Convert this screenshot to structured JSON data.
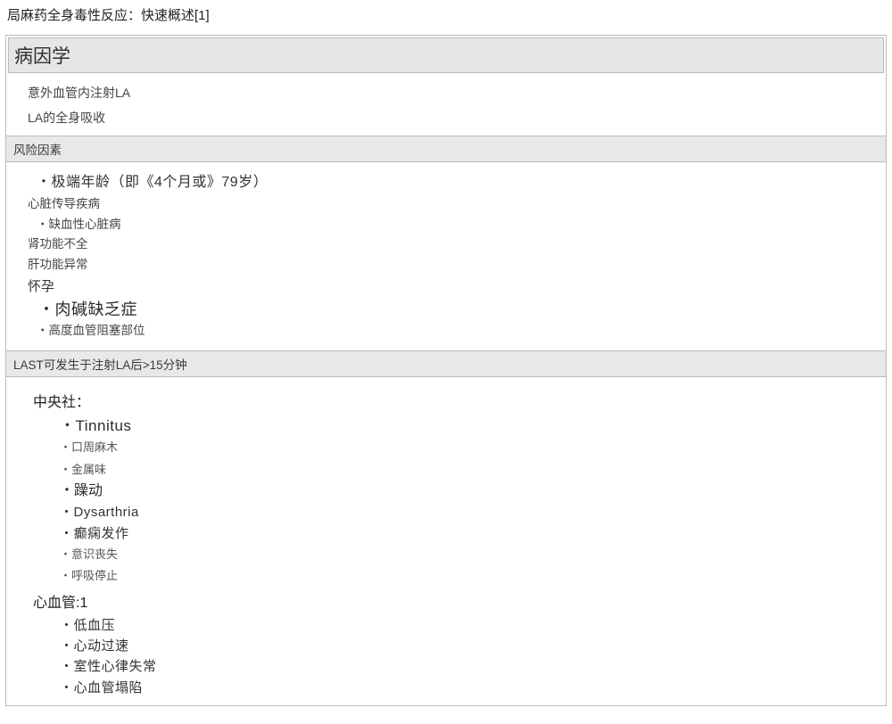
{
  "title": "局麻药全身毒性反应：快速概述[1]",
  "etiology": {
    "header": "病因学",
    "items": [
      "意外血管内注射LA",
      "LA的全身吸收"
    ]
  },
  "risk": {
    "header": "风险因素",
    "items": [
      {
        "text": "・极端年龄（即《4个月或》79岁）",
        "cls": "r-lg"
      },
      {
        "text": "心脏传导疾病",
        "cls": "r-sm"
      },
      {
        "text": "・缺血性心脏病",
        "cls": "r-sm-b"
      },
      {
        "text": "肾功能不全",
        "cls": "r-sm"
      },
      {
        "text": "肝功能异常",
        "cls": "r-sm"
      },
      {
        "text": "怀孕",
        "cls": "r-med"
      },
      {
        "text": "・肉碱缺乏症",
        "cls": "r-xl"
      },
      {
        "text": "・高度血管阻塞部位",
        "cls": "r-sm-b"
      }
    ]
  },
  "signs": {
    "header": "LAST可发生于注射LA后>15分钟",
    "cns": {
      "label": "中央社：",
      "items": [
        {
          "text": "・Tinnitus",
          "cls": "s-xl"
        },
        {
          "text": "・口周麻木",
          "cls": "s-sm"
        },
        {
          "text": "・金属味",
          "cls": "s-sm"
        },
        {
          "text": "・躁动",
          "cls": "s-lg"
        },
        {
          "text": "・Dysarthria",
          "cls": "s-md"
        },
        {
          "text": "・癫痫发作",
          "cls": "s-md"
        },
        {
          "text": "・意识丧失",
          "cls": "s-sm"
        },
        {
          "text": "・呼吸停止",
          "cls": "s-sm"
        }
      ]
    },
    "cv": {
      "label": "心血管:1",
      "items": [
        "・低血压",
        "・心动过速",
        "・室性心律失常",
        "・心血管塌陷"
      ]
    }
  }
}
